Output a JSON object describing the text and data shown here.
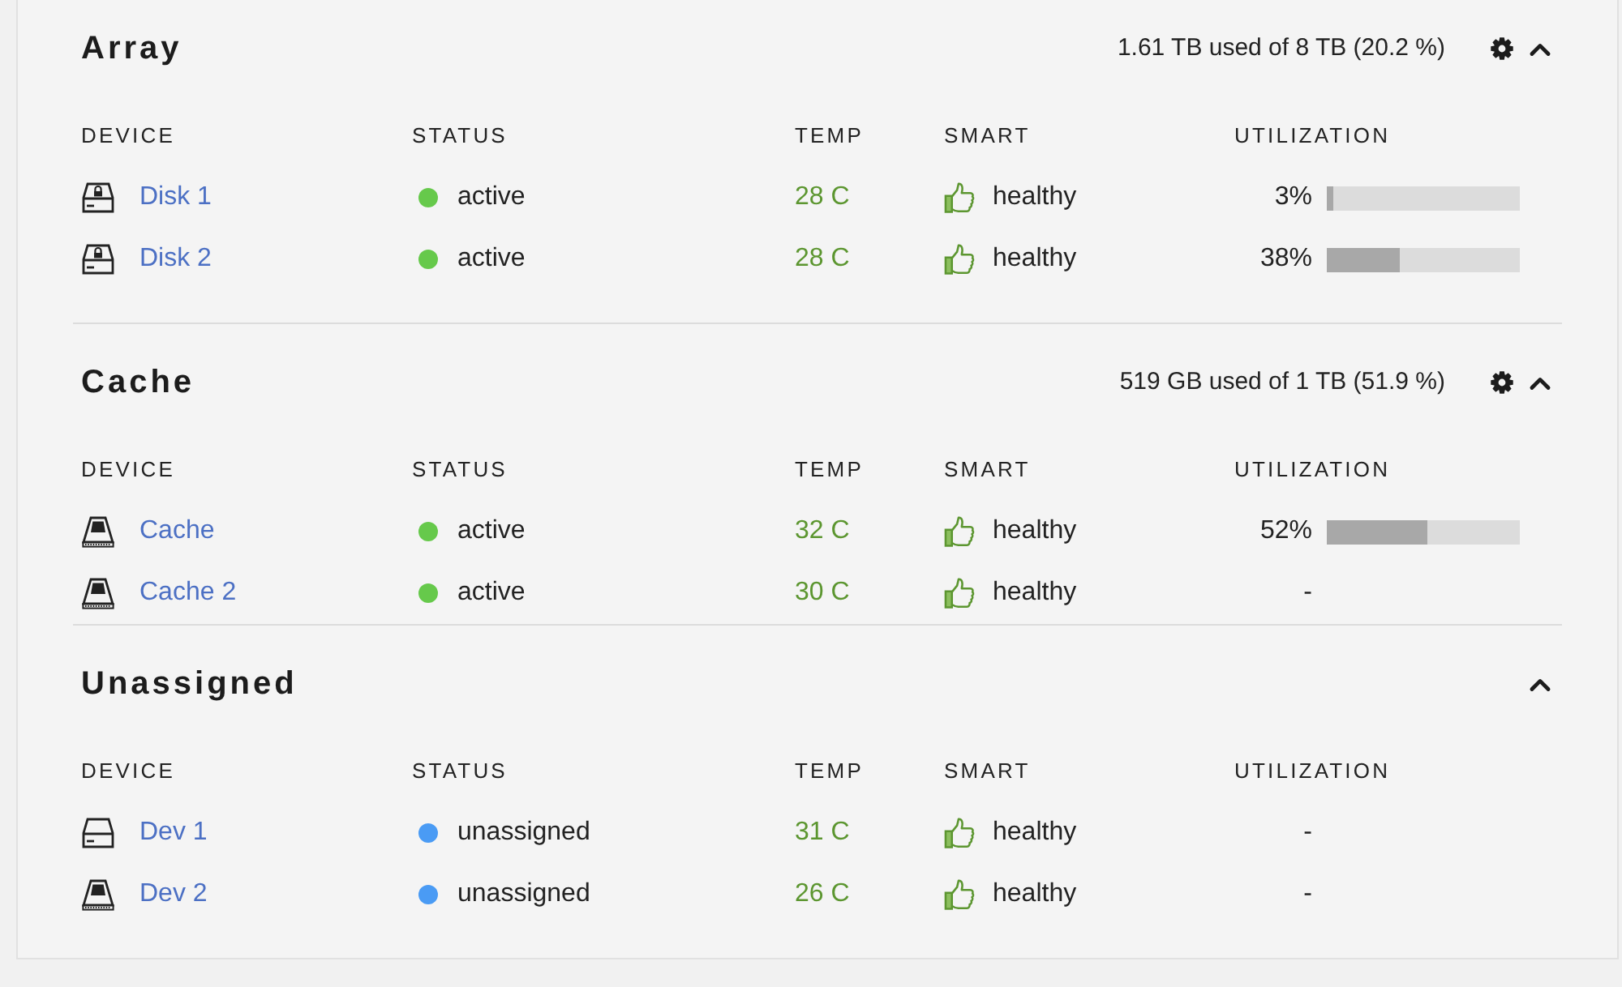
{
  "sections": [
    {
      "title": "Array",
      "usage": "1.61 TB used of 8 TB (20.2 %)",
      "settings": true,
      "expanded": true,
      "columns": [
        "DEVICE",
        "STATUS",
        "TEMP",
        "SMART",
        "UTILIZATION"
      ],
      "devices": [
        {
          "kind": "locked",
          "name": "Disk 1",
          "status": "active",
          "color": "#66c94b",
          "temp": "28 C",
          "smart": "healthy",
          "utilization": "3%",
          "level": 0.03
        },
        {
          "kind": "locked",
          "name": "Disk 2",
          "status": "active",
          "color": "#66c94b",
          "temp": "28 C",
          "smart": "healthy",
          "utilization": "38%",
          "level": 0.38
        }
      ]
    },
    {
      "title": "Cache",
      "usage": "519 GB used of 1 TB (51.9 %)",
      "settings": true,
      "expanded": true,
      "columns": [
        "DEVICE",
        "STATUS",
        "TEMP",
        "SMART",
        "UTILIZATION"
      ],
      "devices": [
        {
          "kind": "ssd",
          "name": "Cache",
          "status": "active",
          "color": "#66c94b",
          "temp": "32 C",
          "smart": "healthy",
          "utilization": "52%",
          "level": 0.52
        },
        {
          "kind": "ssd",
          "name": "Cache 2",
          "status": "active",
          "color": "#66c94b",
          "temp": "30 C",
          "smart": "healthy",
          "utilization": "-"
        }
      ]
    },
    {
      "title": "Unassigned",
      "settings": false,
      "expanded": true,
      "columns": [
        "DEVICE",
        "STATUS",
        "TEMP",
        "SMART",
        "UTILIZATION"
      ],
      "devices": [
        {
          "kind": "hdd",
          "name": "Dev 1",
          "status": "unassigned",
          "color": "#4a9bf4",
          "temp": "31 C",
          "smart": "healthy",
          "utilization": "-"
        },
        {
          "kind": "ssd",
          "name": "Dev 2",
          "status": "unassigned",
          "color": "#4a9bf4",
          "temp": "26 C",
          "smart": "healthy",
          "utilization": "-"
        }
      ]
    }
  ]
}
